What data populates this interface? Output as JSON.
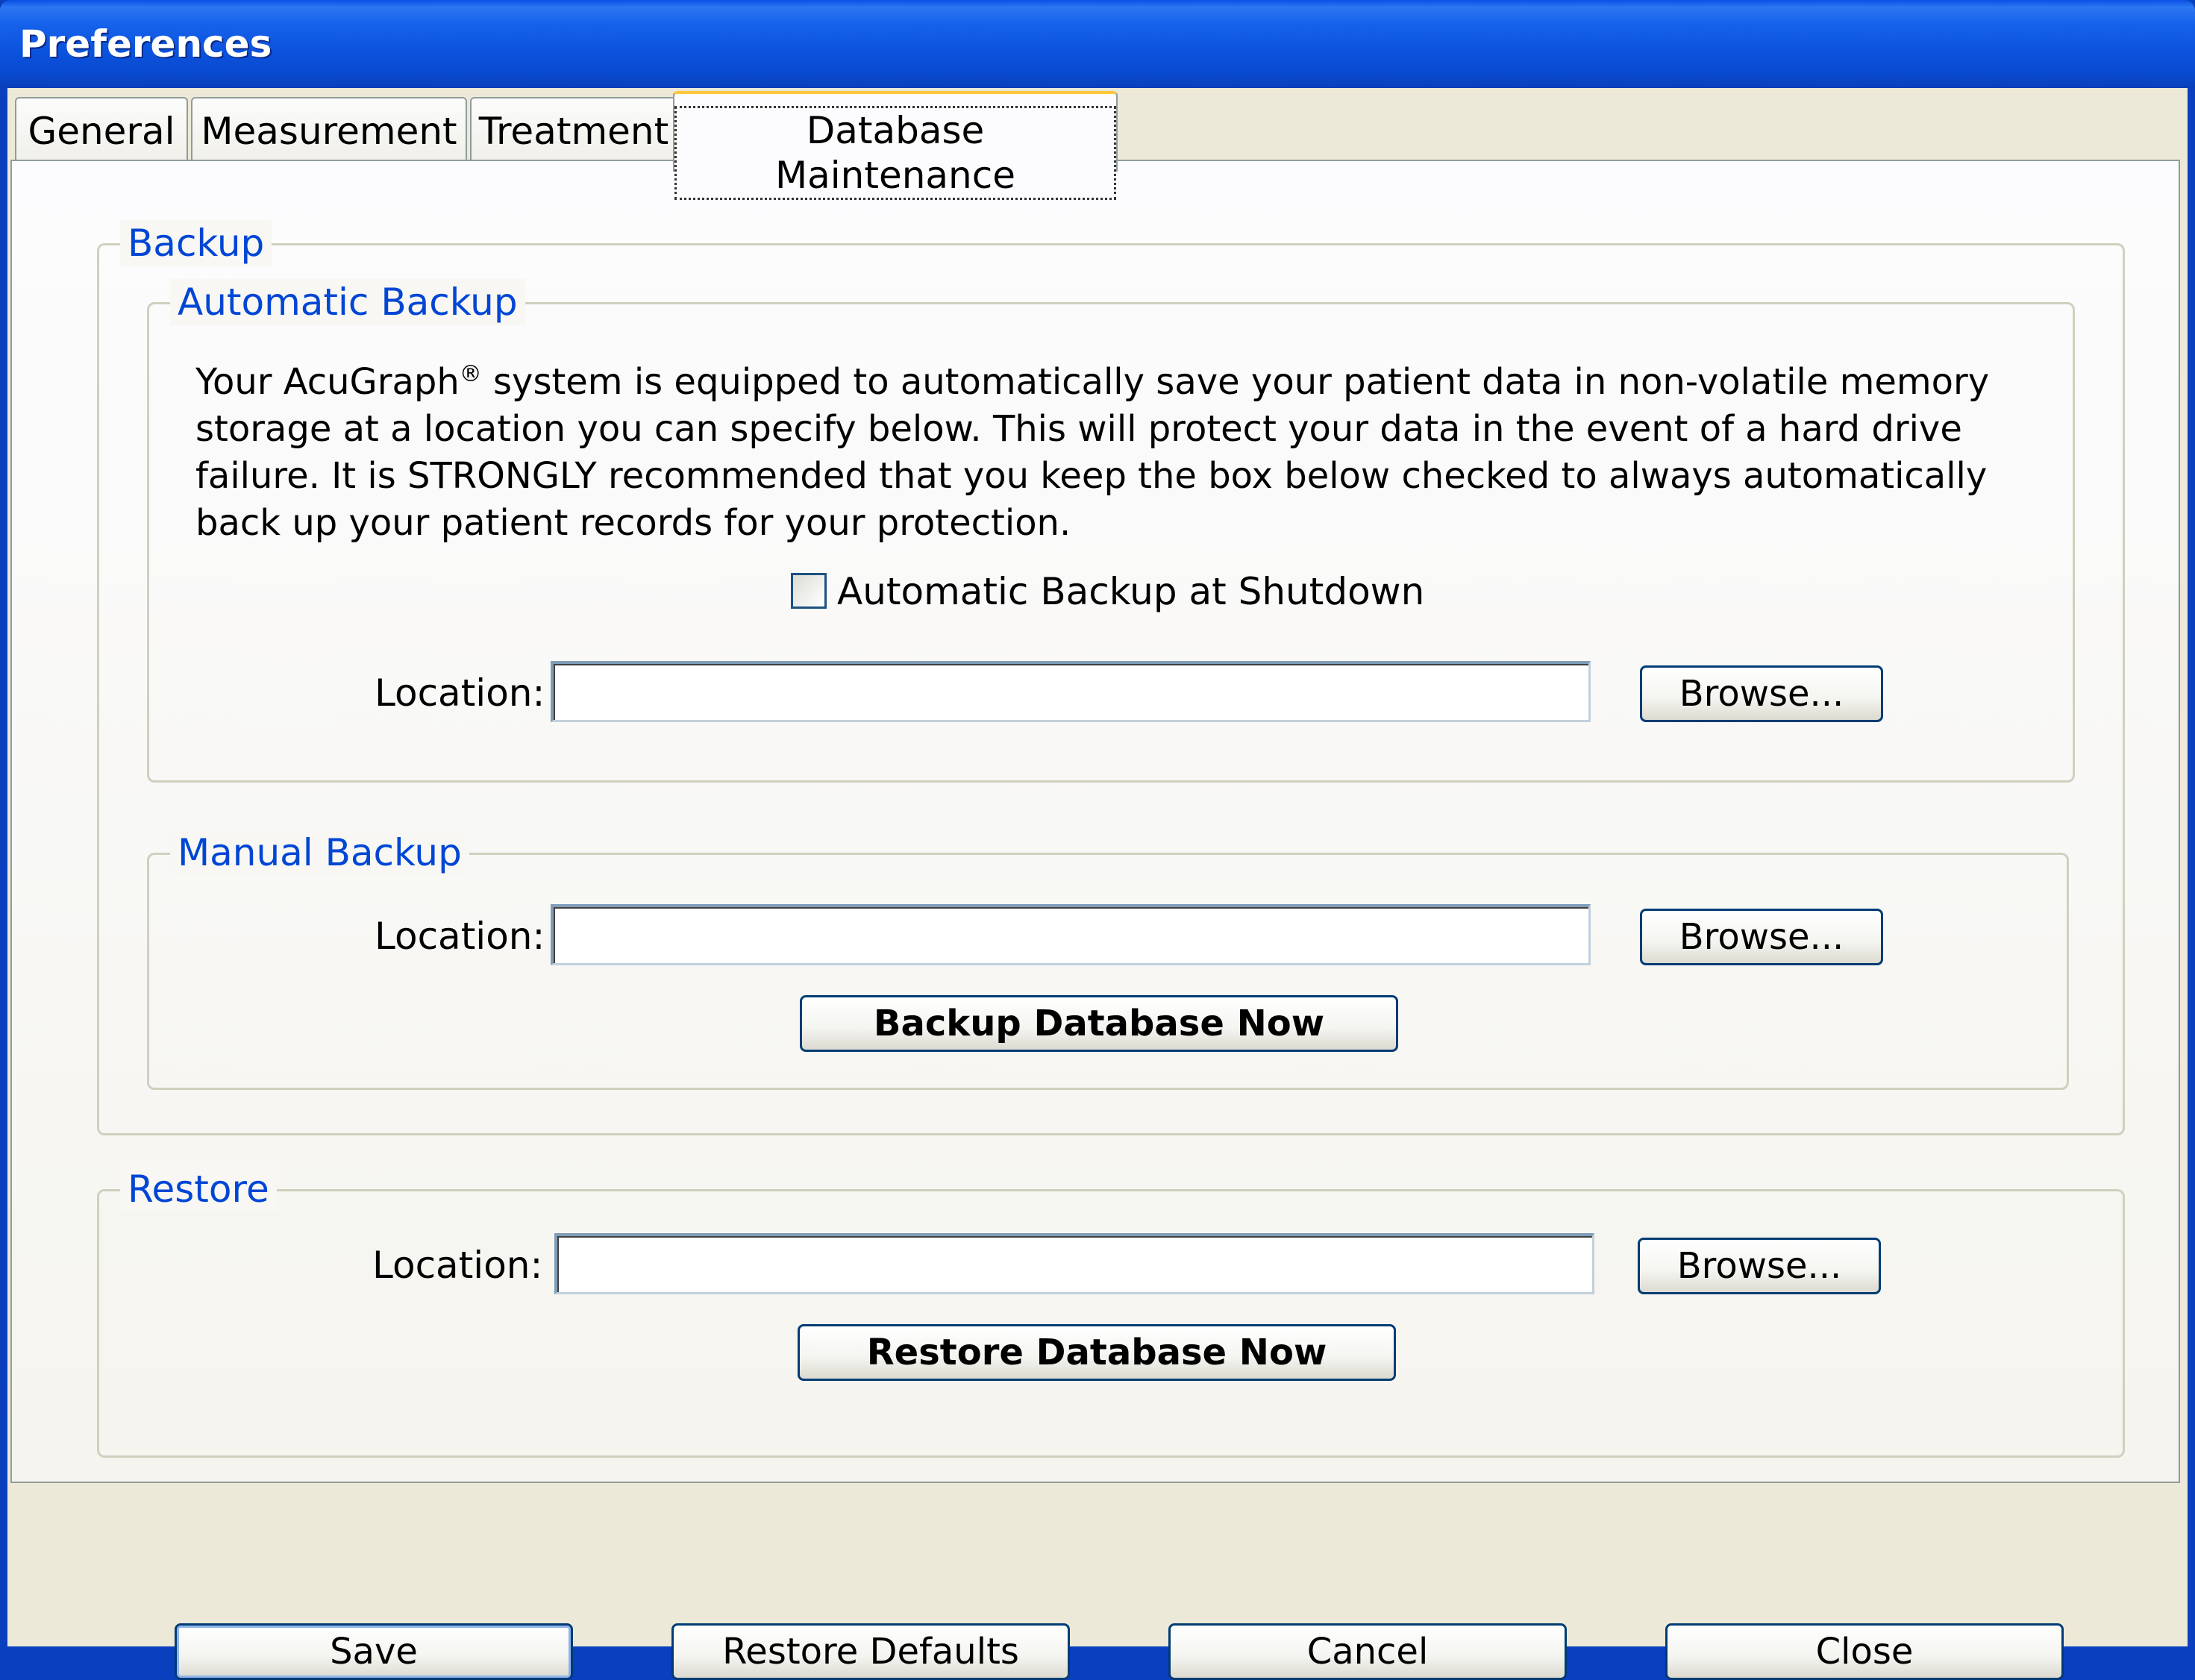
{
  "window": {
    "title": "Preferences"
  },
  "tabs": [
    {
      "label": "General"
    },
    {
      "label": "Measurement"
    },
    {
      "label": "Treatment"
    },
    {
      "label": "Database Maintenance",
      "active": true
    }
  ],
  "backup": {
    "title": "Backup",
    "automatic": {
      "title": "Automatic Backup",
      "description_part1": "Your AcuGraph",
      "registered_mark": "®",
      "description_part2": " system is equipped to automatically save your patient data in non-volatile memory storage at a location you can specify below. This will protect your data in the event of a hard drive failure. It is STRONGLY recommended that you keep the box below checked to always automatically back up your patient records for your protection.",
      "checkbox_label": "Automatic Backup at Shutdown",
      "checkbox_checked": false,
      "location_label": "Location:",
      "location_value": "",
      "browse_label": "Browse..."
    },
    "manual": {
      "title": "Manual Backup",
      "location_label": "Location:",
      "location_value": "",
      "browse_label": "Browse...",
      "action_label": "Backup Database Now"
    }
  },
  "restore": {
    "title": "Restore",
    "location_label": "Location:",
    "location_value": "",
    "browse_label": "Browse...",
    "action_label": "Restore Database Now"
  },
  "footer": {
    "save_label": "Save",
    "restore_defaults_label": "Restore Defaults",
    "cancel_label": "Cancel",
    "close_label": "Close"
  },
  "colors": {
    "title_bar": "#0a4fe3",
    "group_title": "#0046d5",
    "active_tab_accent": "#ffc83c",
    "button_border": "#003c74"
  }
}
